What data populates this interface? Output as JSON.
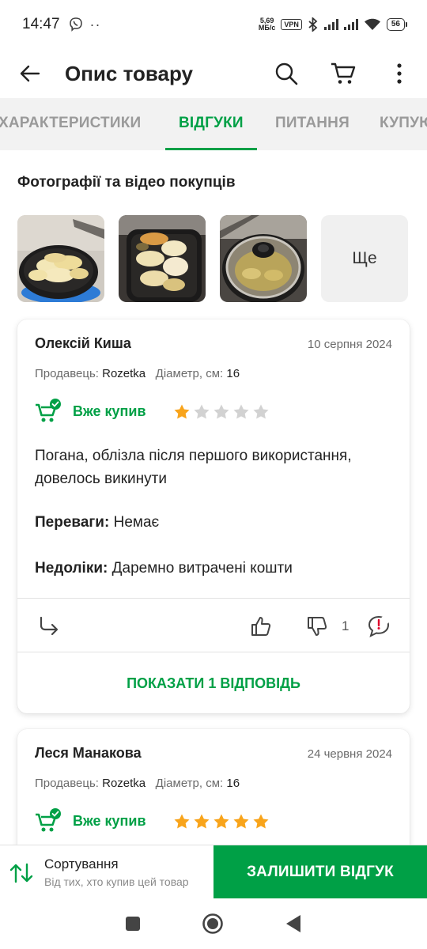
{
  "status_bar": {
    "time": "14:47",
    "net_speed_value": "5,69",
    "net_speed_unit": "МБ/с",
    "vpn": "VPN",
    "battery": "56"
  },
  "app_bar": {
    "title": "Опис товару",
    "icons": [
      "back-arrow-icon",
      "search-icon",
      "cart-icon",
      "more-vert-icon"
    ]
  },
  "tabs": [
    {
      "label": "ХАРАКТЕРИСТИКИ",
      "active": false
    },
    {
      "label": "ВІДГУКИ",
      "active": true
    },
    {
      "label": "ПИТАННЯ",
      "active": false
    },
    {
      "label": "КУПУЮТЬ",
      "active": false
    }
  ],
  "photos_section": {
    "title": "Фотографії та відео покупців",
    "more_label": "Ще"
  },
  "reviews": [
    {
      "author": "Олексій Киша",
      "date": "10 серпня 2024",
      "seller_label": "Продавець:",
      "seller": "Rozetka",
      "param_label": "Діаметр, см:",
      "param_value": "16",
      "bought_label": "Вже купив",
      "rating": 1,
      "text": "Погана, облізла після першого використання, довелось викинути",
      "pros_label": "Переваги:",
      "pros": "Немає",
      "cons_label": "Недоліки:",
      "cons": "Даремно витрачені кошти",
      "dislikes": "1",
      "replies_label": "ПОКАЗАТИ 1 ВІДПОВІДЬ"
    },
    {
      "author": "Леся Манакова",
      "date": "24 червня 2024",
      "seller_label": "Продавець:",
      "seller": "Rozetka",
      "param_label": "Діаметр, см:",
      "param_value": "16",
      "bought_label": "Вже купив",
      "rating": 5
    }
  ],
  "bottom_bar": {
    "sort_title": "Сортування",
    "sort_value": "Від тих, хто купив цей товар",
    "leave_review": "ЗАЛИШИТИ ВІДГУК"
  },
  "colors": {
    "accent": "#00a046",
    "star": "#f8a41b",
    "star_empty": "#d2d2d2",
    "report": "#e0002b"
  }
}
